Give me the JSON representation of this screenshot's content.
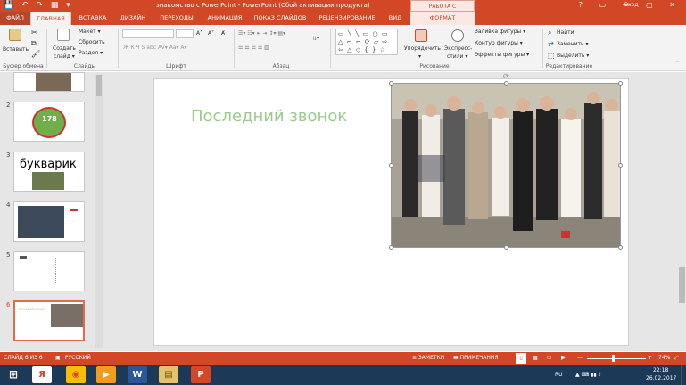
{
  "window": {
    "title": "знакомство с PowerPoint - PowerPoint (Сбой активации продукта)",
    "context_tab_header": "РАБОТА С РИСУНКАМИ",
    "signin": "Вход",
    "qat": "💾 ↶ ↷ ▦ ▾",
    "controls": "? ▭ — ▢ ✕"
  },
  "tabs": [
    "ФАЙЛ",
    "ГЛАВНАЯ",
    "ВСТАВКА",
    "ДИЗАЙН",
    "ПЕРЕХОДЫ",
    "АНИМАЦИЯ",
    "ПОКАЗ СЛАЙДОВ",
    "РЕЦЕНЗИРОВАНИЕ",
    "ВИД",
    "ФОРМАТ"
  ],
  "ribbon": {
    "clipboard": {
      "paste": "Вставить",
      "group": "Буфер обмена"
    },
    "slides": {
      "create": "Создать",
      "create2": "слайд ▾",
      "layout": "Макет ▾",
      "reset": "Сбросить",
      "section": "Раздел ▾",
      "group": "Слайды"
    },
    "font": {
      "grow": "A˄",
      "shrink": "A˅",
      "clear": "A̸",
      "row2": "Ж К Ч S abc AV▾ Aa▾ A▾",
      "group": "Шрифт"
    },
    "paragraph": {
      "row1": "☰▾ ☷▾ ⇤ ⇥ ↕▾ ▤▾",
      "row2": "☰ ☰ ☰ ☰ ▥",
      "row3": "⇅▾",
      "group": "Абзац"
    },
    "drawing": {
      "shapes": "▭ ╲ ╲ ▭ ○ ▭ △ ⌐ ⌐ ⟳ ▱ ⇨ ⇦ △ ◇ { } ☆",
      "arrange": "Упорядочить",
      "arrange2": "▾",
      "quick": "Экспресс-",
      "quick2": "стили ▾",
      "fill": "Заливка фигуры ▾",
      "outline": "Контур фигуры ▾",
      "effects": "Эффекты фигуры ▾",
      "group": "Рисование"
    },
    "editing": {
      "find": "Найти",
      "replace": "Заменить ▾",
      "select": "Выделить ▾",
      "group": "Редактирование"
    }
  },
  "thumbnails": [
    {
      "num": "",
      "text": ""
    },
    {
      "num": "2",
      "text": "178"
    },
    {
      "num": "3",
      "text": "букварик"
    },
    {
      "num": "4",
      "text": ""
    },
    {
      "num": "5",
      "text": ""
    },
    {
      "num": "6",
      "text": "Последний звонок"
    }
  ],
  "slide": {
    "title": "Последний звонок"
  },
  "status": {
    "slide": "СЛАЙД 6 ИЗ 6",
    "lang": "РУССКИЙ",
    "notes": "≡ ЗАМЕТКИ",
    "comments": "▬ ПРИМЕЧАНИЯ",
    "zoom": "74%",
    "zoom_minus": "—",
    "zoom_plus": "+"
  },
  "taskbar": {
    "icons": [
      "Я",
      "◉",
      "▶",
      "W",
      "▤",
      "P"
    ],
    "lang": "RU",
    "tray": "▲ ⌨ ▮▮ ♪",
    "time": "22:18",
    "date": "26.02.2017"
  },
  "colors": {
    "accent": "#d24726",
    "title_green": "#9cc98d",
    "taskbar": "#1c3958"
  }
}
